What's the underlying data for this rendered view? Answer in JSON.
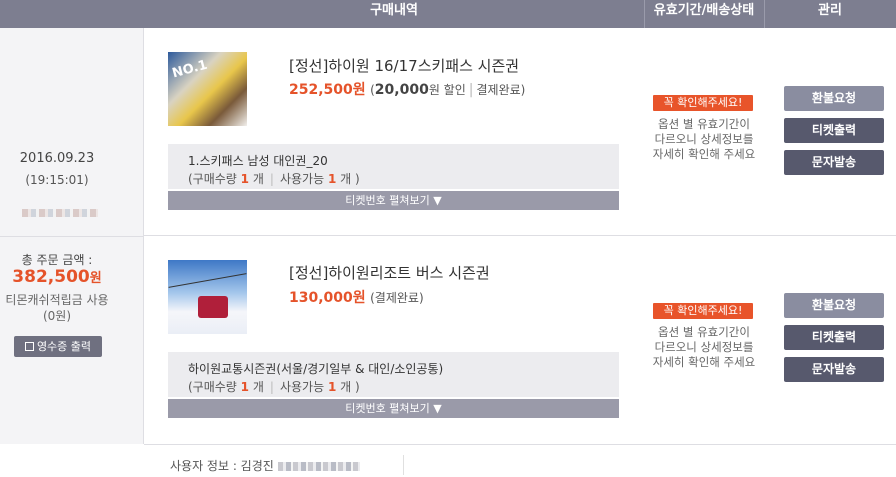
{
  "header": {
    "col_order": "구매내역",
    "col_validity": "유효기간/배송상태",
    "col_manage": "관리"
  },
  "order": {
    "date": "2016.09.23",
    "time": "(19:15:01)",
    "total_label": "총 주문 금액 :",
    "total_amount": "382,500",
    "total_unit": "원",
    "points_label": "티몬캐쉬적립금 사용",
    "points_value": "(0원)",
    "receipt_button": "영수증 출력"
  },
  "items": [
    {
      "title": "[정선]하이원 16/17스키패스 시즌권",
      "price": "252,500",
      "price_unit": "원",
      "discount": "20,000",
      "discount_suffix": "원 할인",
      "status": "결제완료",
      "option_name": "1.스키패스 남성 대인권_20",
      "qty_label": "(구매수량",
      "qty": "1",
      "qty_unit": "개",
      "avail_label": "사용가능",
      "avail": "1",
      "avail_unit": "개 )",
      "expand_label": "티켓번호 펼쳐보기 ▼",
      "badge": "꼭 확인해주세요!",
      "note_line1": "옵션 별 유효기간이",
      "note_line2": "다르오니 상세정보를",
      "note_line3": "자세히 확인해 주세요",
      "btn_refund": "환불요청",
      "btn_ticket": "티켓출력",
      "btn_sms": "문자발송"
    },
    {
      "title": "[정선]하이원리조트 버스 시즌권",
      "price": "130,000",
      "price_unit": "원",
      "status": "(결제완료)",
      "option_name": "하이원교통시즌권(서울/경기일부 & 대인/소인공통)",
      "qty_label": "(구매수량",
      "qty": "1",
      "qty_unit": "개",
      "avail_label": "사용가능",
      "avail": "1",
      "avail_unit": "개 )",
      "expand_label": "티켓번호 펼쳐보기 ▼",
      "badge": "꼭 확인해주세요!",
      "note_line1": "옵션 별 유효기간이",
      "note_line2": "다르오니 상세정보를",
      "note_line3": "자세히 확인해 주세요",
      "btn_refund": "환불요청",
      "btn_ticket": "티켓출력",
      "btn_sms": "문자발송"
    }
  ],
  "user": {
    "label": "사용자 정보 : 김경진"
  },
  "colors": {
    "header_bg": "#7d7e90",
    "accent": "#e5532a",
    "badge": "#e8542a",
    "btn_light": "#8a8da0",
    "btn_dark": "#57596d"
  },
  "icons": [
    "receipt-icon",
    "chevron-down-icon"
  ]
}
